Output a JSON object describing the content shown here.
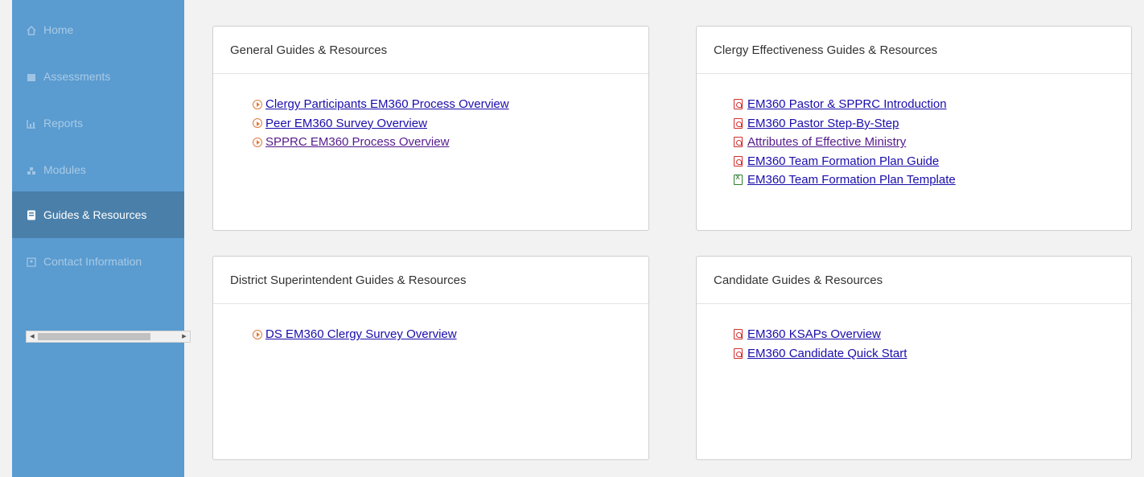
{
  "sidebar": {
    "items": [
      {
        "label": "Home",
        "icon": "home-icon",
        "active": false
      },
      {
        "label": "Assessments",
        "icon": "clipboard-icon",
        "active": false
      },
      {
        "label": "Reports",
        "icon": "chart-icon",
        "active": false
      },
      {
        "label": "Modules",
        "icon": "modules-icon",
        "active": false
      },
      {
        "label": "Guides & Resources",
        "icon": "book-icon",
        "active": true
      },
      {
        "label": "Contact Information",
        "icon": "contact-icon",
        "active": false
      }
    ]
  },
  "cards": {
    "general": {
      "title": "General Guides & Resources",
      "links": [
        "Clergy Participants EM360 Process Overview",
        "Peer EM360 Survey Overview",
        "SPPRC EM360 Process Overview"
      ]
    },
    "clergy": {
      "title": "Clergy Effectiveness Guides & Resources",
      "links": [
        "EM360 Pastor & SPPRC Introduction",
        "EM360 Pastor Step-By-Step",
        "Attributes of Effective Ministry",
        "EM360 Team Formation Plan Guide",
        "EM360 Team Formation Plan Template"
      ]
    },
    "district": {
      "title": "District Superintendent Guides & Resources",
      "links": [
        "DS EM360 Clergy Survey Overview"
      ]
    },
    "candidate": {
      "title": "Candidate Guides & Resources",
      "links": [
        "EM360 KSAPs Overview",
        "EM360 Candidate Quick Start"
      ]
    }
  },
  "colors": {
    "sidebar_bg": "#5a9bd0",
    "sidebar_active_bg": "#4a7fa9",
    "link": "#1a0dab",
    "pdf_icon": "#d32f2f",
    "excel_icon": "#2e7d32",
    "video_icon": "#e07a3a"
  }
}
